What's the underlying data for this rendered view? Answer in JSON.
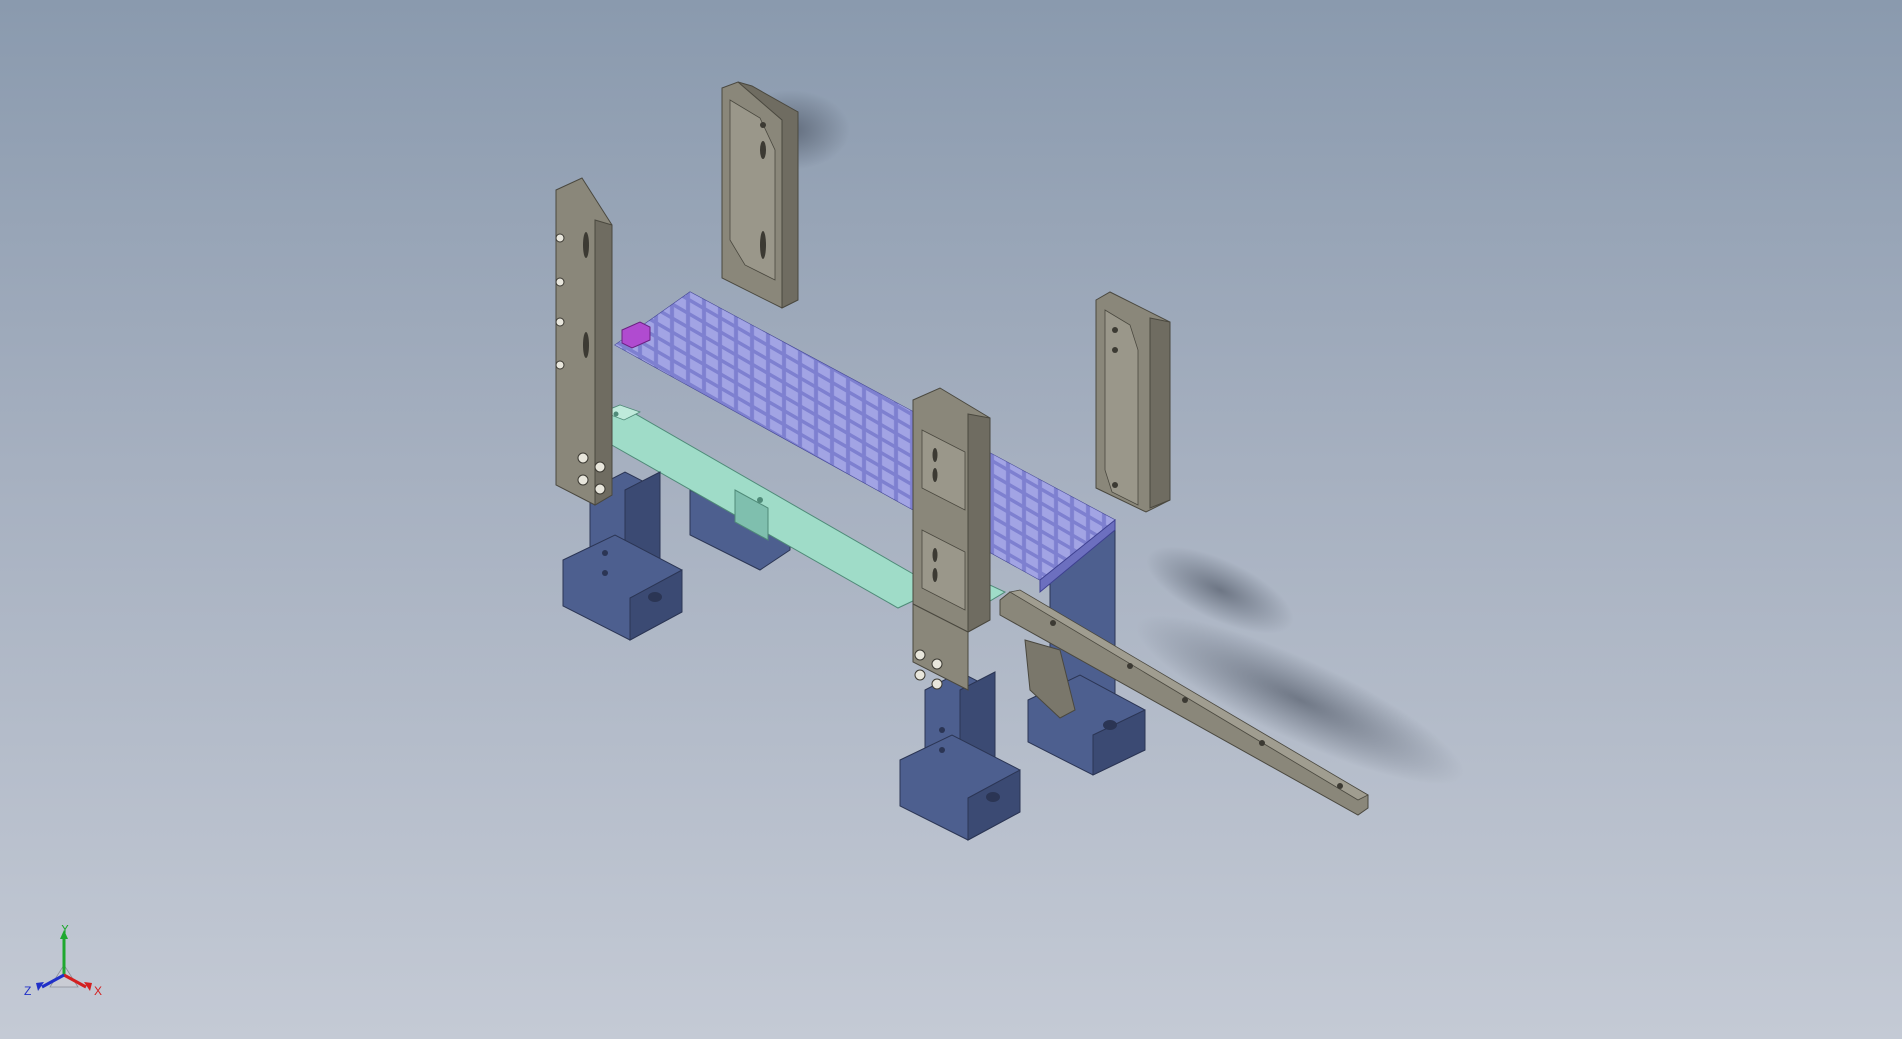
{
  "viewport": {
    "background_top": "#8a9aae",
    "background_bottom": "#c4cad5"
  },
  "model": {
    "colors": {
      "upright": "#8a877a",
      "upright_dark": "#6f6c61",
      "upright_light": "#a09d90",
      "tray": "#8c8ed6",
      "tray_dark": "#6c6fbf",
      "tray_cell": "#a4a6e6",
      "base_plate": "#9fdcc8",
      "base_plate_dark": "#7fbfae",
      "leg": "#4d5f8f",
      "leg_dark": "#3b4a73",
      "leg_light": "#6275a8",
      "rail": "#8a877a",
      "accent_part": "#b04bd0"
    }
  },
  "triad": {
    "y_label": "Y",
    "x_label": "X",
    "z_label": "Z",
    "y_color": "#1fa82f",
    "x_color": "#d32020",
    "z_color": "#2030c8"
  }
}
